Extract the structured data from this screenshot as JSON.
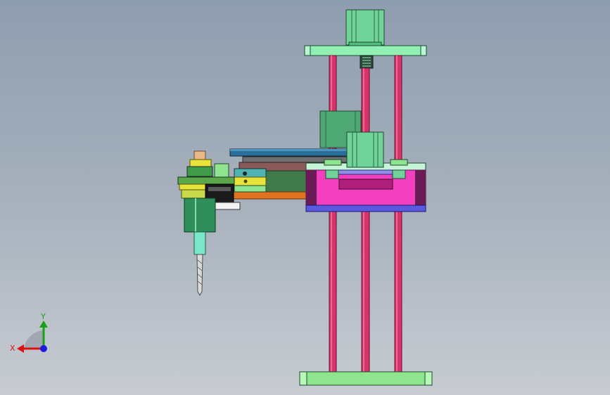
{
  "viewport": {
    "view": "front"
  },
  "triad": {
    "x_label": "X",
    "y_label": "Y",
    "x_color": "#e01010",
    "y_color": "#1aa01a",
    "z_color": "#1a1ae0"
  },
  "colors": {
    "rod": "#d6336b",
    "motor": "#6fd39a",
    "plate_light": "#93f0b5",
    "base_plate": "#8fe58f",
    "magenta_block": "#f23fbf",
    "purple_strip": "#5a5ae0",
    "dark_green_arm": "#3f7a4a",
    "orange_arm": "#e0731f",
    "blue_top_plate": "#2a6f9a",
    "spindle": "#2f8f5a",
    "yellow_part": "#e8e23a"
  }
}
